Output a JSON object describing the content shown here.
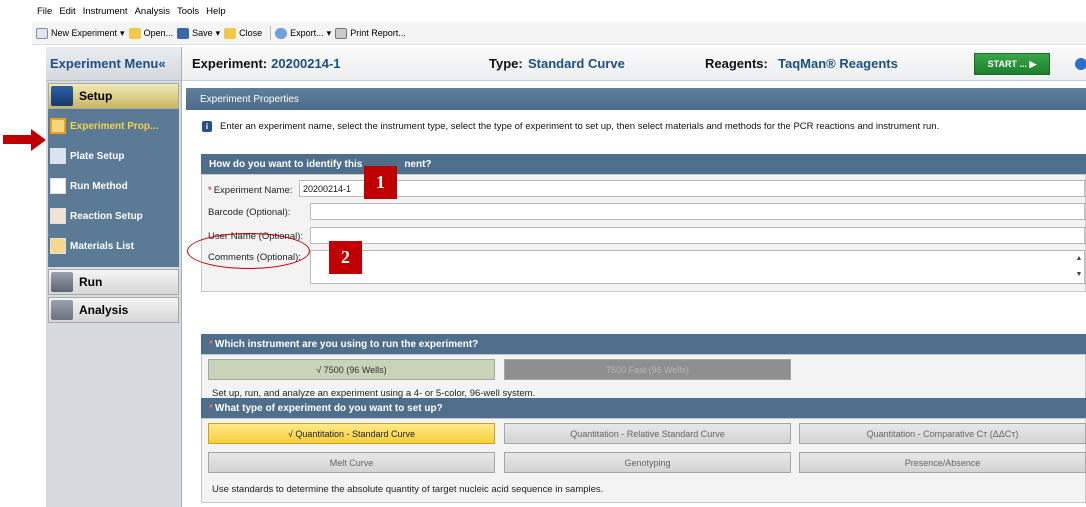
{
  "menu": [
    "File",
    "Edit",
    "Instrument",
    "Analysis",
    "Tools",
    "Help"
  ],
  "toolbar": {
    "new_experiment": "New Experiment",
    "open": "Open...",
    "save": "Save",
    "close": "Close",
    "export": "Export...",
    "print_report": "Print Report..."
  },
  "sidebar": {
    "title": "Experiment Menu«",
    "setup": "Setup",
    "items": [
      {
        "label": "Experiment Prop..."
      },
      {
        "label": "Plate Setup"
      },
      {
        "label": "Run Method"
      },
      {
        "label": "Reaction Setup"
      },
      {
        "label": "Materials List"
      }
    ],
    "run": "Run",
    "analysis": "Analysis"
  },
  "header": {
    "experiment_label": "Experiment:",
    "experiment_value": "20200214-1",
    "type_label": "Type:",
    "type_value": "Standard Curve",
    "reagents_label": "Reagents:",
    "reagents_value": "TaqMan® Reagents",
    "start": "START ... ▶"
  },
  "props": {
    "title": "Experiment Properties",
    "info": "Enter an experiment name, select the instrument type, select the type of experiment to set up, then select materials and methods for the PCR reactions and instrument run."
  },
  "identify": {
    "title": "How do you want to identify this experiment?",
    "title_visible": "How do you want to identify this",
    "title_tail": "nent?",
    "name_label": "Experiment Name:",
    "name_value": "20200214-1",
    "barcode_label": "Barcode (Optional):",
    "user_label": "User Name (Optional):",
    "comments_label": "Comments (Optional):"
  },
  "annotations": {
    "badge1": "1",
    "badge2": "2"
  },
  "instrument": {
    "title": "Which instrument are you using to run the experiment?",
    "opt1": "√ 7500 (96 Wells)",
    "opt2": "7500 Fast (96 Wells)",
    "desc": "Set up, run, and analyze an experiment using a 4- or 5-color, 96-well system."
  },
  "exptype": {
    "title": "What type of experiment do you want to set up?",
    "options": [
      "√ Quantitation - Standard Curve",
      "Quantitation - Relative Standard Curve",
      "Quantitation - Comparative Cт (ΔΔCт)",
      "Melt Curve",
      "Genotyping",
      "Presence/Absence"
    ],
    "desc": "Use standards to determine the absolute quantity of target nucleic acid sequence in samples."
  },
  "colors": {
    "accent_red": "#c00000",
    "section_blue": "#4e6e8c",
    "start_green": "#1c7f2c"
  }
}
